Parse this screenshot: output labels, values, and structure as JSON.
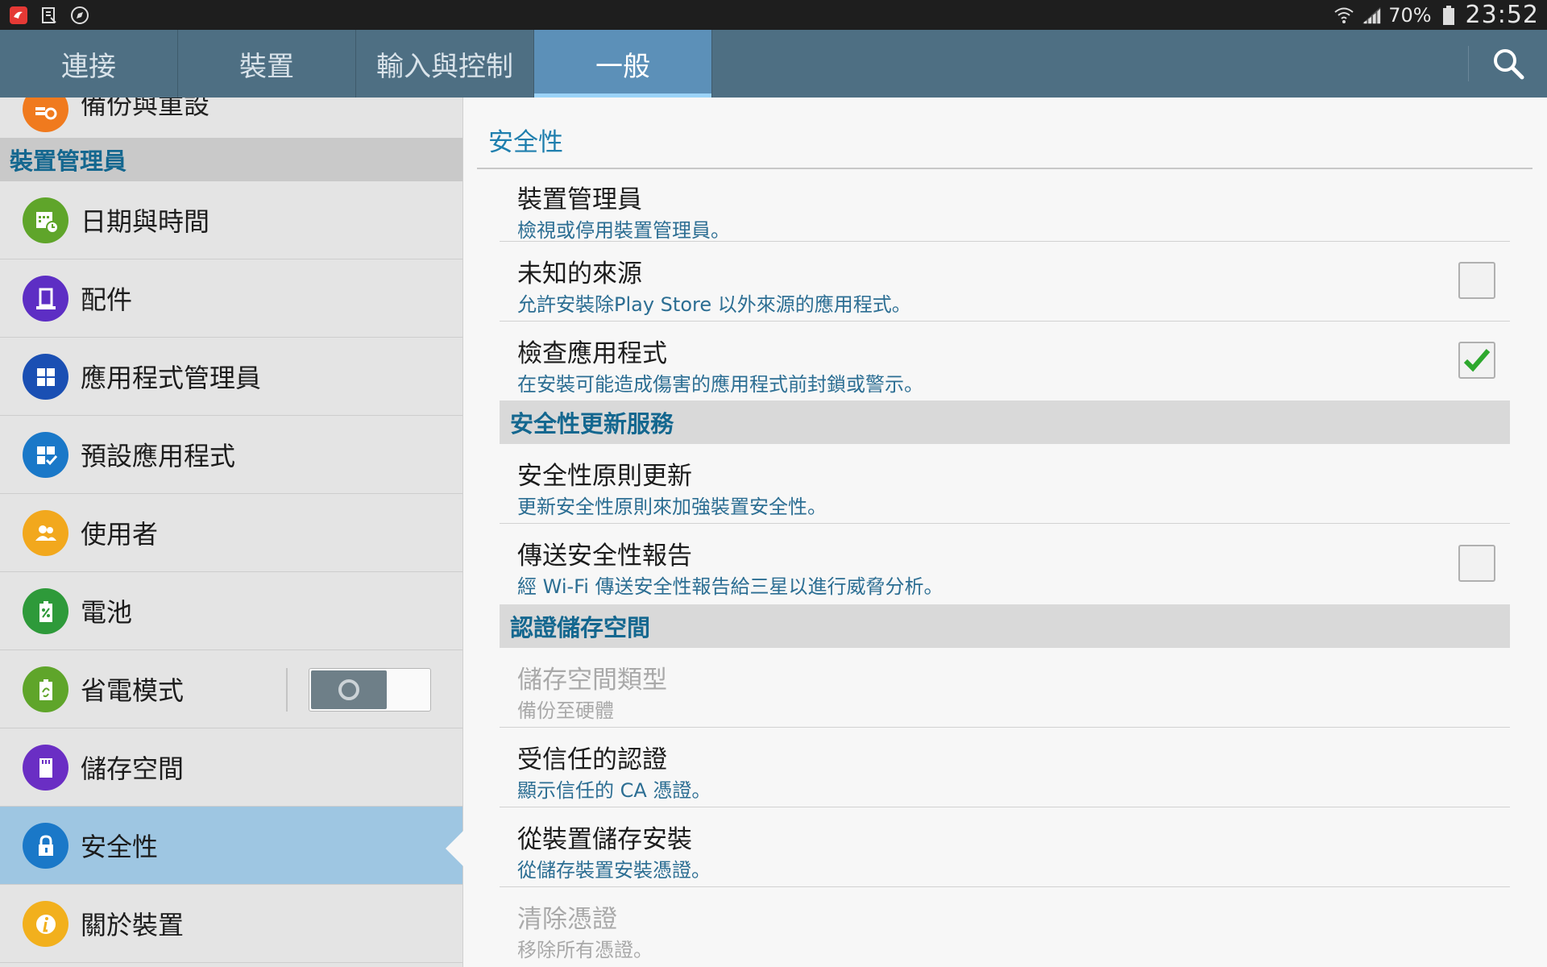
{
  "status_bar": {
    "battery": "70%",
    "time": "23:52",
    "icons": [
      "app-flipboard-icon",
      "notification-mail-icon",
      "compass-icon",
      "wifi-icon",
      "signal-icon",
      "battery-icon"
    ]
  },
  "tabs": [
    {
      "label": "連接",
      "active": false
    },
    {
      "label": "裝置",
      "active": false
    },
    {
      "label": "輸入與控制",
      "active": false
    },
    {
      "label": "一般",
      "active": true
    }
  ],
  "sidebar": {
    "partial_item": "備份與重設",
    "section_title": "裝置管理員",
    "items": [
      {
        "label": "日期與時間",
        "icon": "calendar-clock-icon",
        "color": "#5fa52a"
      },
      {
        "label": "配件",
        "icon": "accessory-icon",
        "color": "#5d2ec4"
      },
      {
        "label": "應用程式管理員",
        "icon": "grid-icon",
        "color": "#1a4fb3"
      },
      {
        "label": "預設應用程式",
        "icon": "grid-check-icon",
        "color": "#1a78c8"
      },
      {
        "label": "使用者",
        "icon": "users-icon",
        "color": "#f2a81d"
      },
      {
        "label": "電池",
        "icon": "battery-percent-icon",
        "color": "#2e9a3a"
      },
      {
        "label": "省電模式",
        "icon": "power-saving-icon",
        "color": "#5fa52a"
      },
      {
        "label": "儲存空間",
        "icon": "sd-card-icon",
        "color": "#6a2ec4"
      },
      {
        "label": "安全性",
        "icon": "lock-icon",
        "color": "#1a78c8",
        "selected": true
      },
      {
        "label": "關於裝置",
        "icon": "info-icon",
        "color": "#f2b01d"
      }
    ],
    "power_saving_toggle": false
  },
  "main": {
    "title": "安全性",
    "rows_a": [
      {
        "title": "裝置管理員",
        "subtitle": "檢視或停用裝置管理員。"
      },
      {
        "title": "未知的來源",
        "subtitle": "允許安裝除Play Store 以外來源的應用程式。",
        "checked": false
      },
      {
        "title": "檢查應用程式",
        "subtitle": "在安裝可能造成傷害的應用程式前封鎖或警示。",
        "checked": true
      }
    ],
    "section_b": "安全性更新服務",
    "rows_b": [
      {
        "title": "安全性原則更新",
        "subtitle": "更新安全性原則來加強裝置安全性。"
      },
      {
        "title": "傳送安全性報告",
        "subtitle": "經 Wi-Fi 傳送安全性報告給三星以進行威脅分析。",
        "checked": false
      }
    ],
    "section_c": "認證儲存空間",
    "rows_c": [
      {
        "title": "儲存空間類型",
        "subtitle": "備份至硬體",
        "disabled": true
      },
      {
        "title": "受信任的認證",
        "subtitle": "顯示信任的 CA 憑證。"
      },
      {
        "title": "從裝置儲存安裝",
        "subtitle": "從儲存裝置安裝憑證。"
      },
      {
        "title": "清除憑證",
        "subtitle": "移除所有憑證。",
        "disabled": true
      }
    ]
  }
}
